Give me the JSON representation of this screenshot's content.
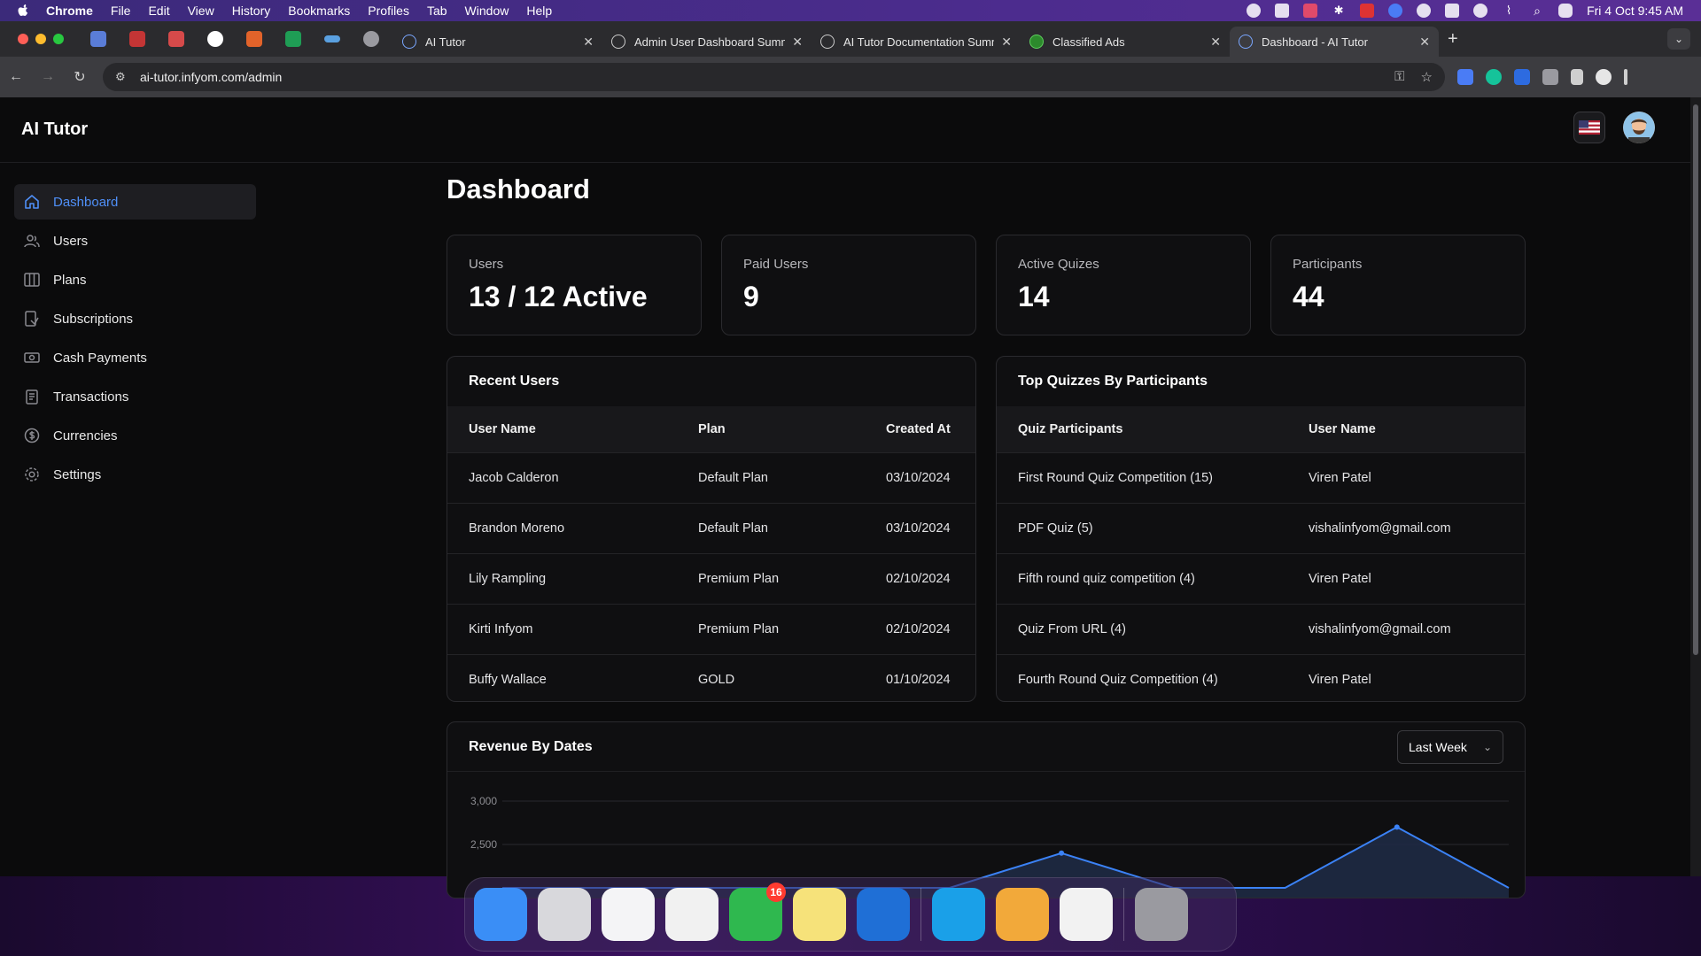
{
  "menubar": {
    "app": "Chrome",
    "items": [
      "File",
      "Edit",
      "View",
      "History",
      "Bookmarks",
      "Profiles",
      "Tab",
      "Window",
      "Help"
    ],
    "clock": "Fri 4 Oct  9:45 AM"
  },
  "browser": {
    "tabs": [
      {
        "title": "AI Tutor"
      },
      {
        "title": "Admin User Dashboard Summ"
      },
      {
        "title": "AI Tutor Documentation Summ"
      },
      {
        "title": "Classified Ads"
      },
      {
        "title": "Dashboard - AI Tutor"
      }
    ],
    "url": "ai-tutor.infyom.com/admin"
  },
  "app": {
    "brand": "AI Tutor"
  },
  "sidebar": {
    "items": [
      {
        "label": "Dashboard",
        "icon": "home-icon"
      },
      {
        "label": "Users",
        "icon": "users-icon"
      },
      {
        "label": "Plans",
        "icon": "columns-icon"
      },
      {
        "label": "Subscriptions",
        "icon": "subscriptions-icon"
      },
      {
        "label": "Cash Payments",
        "icon": "cash-icon"
      },
      {
        "label": "Transactions",
        "icon": "clipboard-icon"
      },
      {
        "label": "Currencies",
        "icon": "dollar-icon"
      },
      {
        "label": "Settings",
        "icon": "gear-icon"
      }
    ]
  },
  "page": {
    "title": "Dashboard"
  },
  "stats": [
    {
      "label": "Users",
      "value": "13 / 12 Active"
    },
    {
      "label": "Paid Users",
      "value": "9"
    },
    {
      "label": "Active Quizes",
      "value": "14"
    },
    {
      "label": "Participants",
      "value": "44"
    }
  ],
  "recent_users": {
    "title": "Recent Users",
    "columns": [
      "User Name",
      "Plan",
      "Created At"
    ],
    "rows": [
      [
        "Jacob Calderon",
        "Default Plan",
        "03/10/2024"
      ],
      [
        "Brandon Moreno",
        "Default Plan",
        "03/10/2024"
      ],
      [
        "Lily Rampling",
        "Premium Plan",
        "02/10/2024"
      ],
      [
        "Kirti Infyom",
        "Premium Plan",
        "02/10/2024"
      ],
      [
        "Buffy Wallace",
        "GOLD",
        "01/10/2024"
      ]
    ]
  },
  "top_quizzes": {
    "title": "Top Quizzes By Participants",
    "columns": [
      "Quiz Participants",
      "User Name"
    ],
    "rows": [
      [
        "First Round Quiz Competition (15)",
        "Viren Patel"
      ],
      [
        "PDF Quiz (5)",
        "vishalinfyom@gmail.com"
      ],
      [
        "Fifth round quiz competition (4)",
        "Viren Patel"
      ],
      [
        "Quiz From URL (4)",
        "vishalinfyom@gmail.com"
      ],
      [
        "Fourth Round Quiz Competition (4)",
        "Viren Patel"
      ]
    ]
  },
  "revenue": {
    "title": "Revenue By Dates",
    "period": "Last Week"
  },
  "chart_data": {
    "type": "area",
    "title": "Revenue By Dates",
    "y_ticks": [
      "3,000",
      "2,500"
    ],
    "ylim": [
      2000,
      3000
    ],
    "x": [
      0,
      1,
      2,
      3,
      4,
      5,
      6,
      7,
      8,
      9
    ],
    "values": [
      2000,
      2000,
      2000,
      2000,
      2000,
      2400,
      2000,
      2000,
      2700,
      2000
    ],
    "grid": true,
    "colors": {
      "stroke": "#3b82f6",
      "fill": "#1e2a44"
    }
  },
  "dock": {
    "apps": [
      {
        "name": "finder-icon",
        "color": "#3a8ef6"
      },
      {
        "name": "launchpad-icon",
        "color": "#d8d8dc"
      },
      {
        "name": "vscode-icon",
        "color": "#f4f4f6"
      },
      {
        "name": "chrome-icon",
        "color": "#f1f1f1"
      },
      {
        "name": "messenger-icon",
        "color": "#2fb84f",
        "badge": "16"
      },
      {
        "name": "notes-icon",
        "color": "#f6e27a"
      },
      {
        "name": "thunderbird-icon",
        "color": "#1f6fd6"
      },
      {
        "name": "skype-icon",
        "color": "#1aa0e8"
      },
      {
        "name": "tableplus-icon",
        "color": "#f2a93a"
      },
      {
        "name": "hilite-icon",
        "color": "#f2f2f2"
      },
      {
        "name": "trash-icon",
        "color": "#9a9aa0"
      }
    ]
  }
}
